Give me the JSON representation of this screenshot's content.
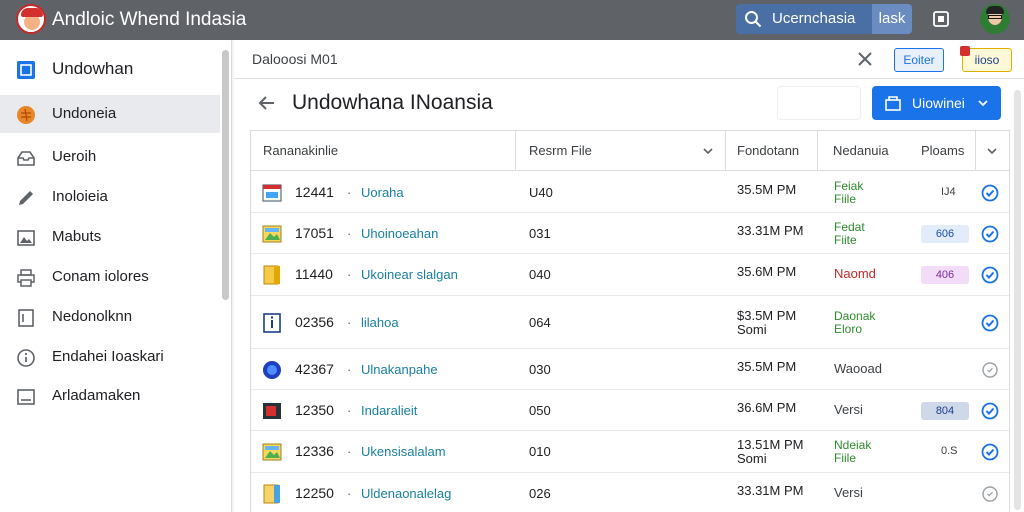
{
  "app": {
    "title": "Andloic Whend Indasia"
  },
  "search": {
    "label": "Ucernchasia",
    "extra": "lask"
  },
  "sidebar": {
    "items": [
      {
        "label": "Undowhan",
        "icon": "square-icon"
      },
      {
        "label": "Undoneia",
        "icon": "flag-icon"
      },
      {
        "label": "Ueroih",
        "icon": "inbox-icon"
      },
      {
        "label": "Inoloieia",
        "icon": "pencil-icon"
      },
      {
        "label": "Mabuts",
        "icon": "image-icon"
      },
      {
        "label": "Conam iolores",
        "icon": "printer-icon"
      },
      {
        "label": "Nedonolknn",
        "icon": "document-icon"
      },
      {
        "label": "Endahei Ioaskari",
        "icon": "info-icon"
      },
      {
        "label": "Arladamaken",
        "icon": "archive-icon"
      }
    ]
  },
  "header": {
    "breadcrumb": "Dalooosi M01",
    "btn_small": "Eoiter",
    "btn_badge": "iioso",
    "title": "Undowhana INoansia",
    "primary_button": "Uiowinei"
  },
  "table": {
    "columns": [
      "Rananakinlie",
      "Resrm File",
      "Fondotann",
      "Nedanuia",
      "Ploams"
    ],
    "rows": [
      {
        "id": "12441",
        "name": "Uoraha",
        "num": "U40",
        "time": "35.5M PM",
        "status": "Feiak\nFiile",
        "status_color": "#2e8b2e",
        "badge": "",
        "plain": "IJ4",
        "icon": "image-file-red-icon",
        "check": "checked"
      },
      {
        "id": "17051",
        "name": "Uhoinoeahan",
        "num": "031",
        "time": "33.31M PM",
        "status": "Fedat\nFiite",
        "status_color": "#2e8b2e",
        "badge": "606",
        "badge_style": "blue",
        "plain": "",
        "icon": "landscape-file-icon",
        "check": "checked"
      },
      {
        "id": "11440",
        "name": "Ukoinear slalgan",
        "num": "040",
        "time": "35.6M PM",
        "status": "Naomd",
        "status_color": "#c62828",
        "badge": "406",
        "badge_style": "purple",
        "plain": "",
        "icon": "folder-yellow-icon",
        "check": "checked"
      },
      {
        "id": "02356",
        "name": "lilahoa",
        "num": "064",
        "time": "$3.5M PM\nSomi",
        "status": "Daonak\nEloro",
        "status_color": "#2e8b2e",
        "badge": "",
        "plain": "",
        "icon": "document-info-icon",
        "check": "checked"
      },
      {
        "id": "42367",
        "name": "Ulnakanpahe",
        "num": "030",
        "time": "35.5M PM",
        "status": "Waooad",
        "status_color": "#3c4043",
        "badge": "",
        "plain": "",
        "icon": "blue-circle-icon",
        "check": "unchecked"
      },
      {
        "id": "12350",
        "name": "Indaralieit",
        "num": "050",
        "time": "36.6M PM",
        "status": "Versi",
        "status_color": "#3c4043",
        "badge": "804",
        "badge_style": "slate",
        "plain": "",
        "icon": "dark-file-icon",
        "check": "checked"
      },
      {
        "id": "12336",
        "name": "Ukensisalalam",
        "num": "010",
        "time": "13.51M PM\nSomi",
        "status": "Ndeiak\nFiile",
        "status_color": "#2e8b2e",
        "badge": "",
        "plain": "0.S",
        "icon": "landscape-file-icon",
        "check": "checked"
      },
      {
        "id": "12250",
        "name": "Uldenaonalelag",
        "num": "026",
        "time": "33.31M PM",
        "status": "Versi",
        "status_color": "#3c4043",
        "badge": "",
        "plain": "",
        "icon": "folder-blue-icon",
        "check": "unchecked"
      }
    ]
  },
  "colors": {
    "accent": "#1a73e8",
    "topbar": "#5f6368",
    "link": "#1a7fa0"
  }
}
